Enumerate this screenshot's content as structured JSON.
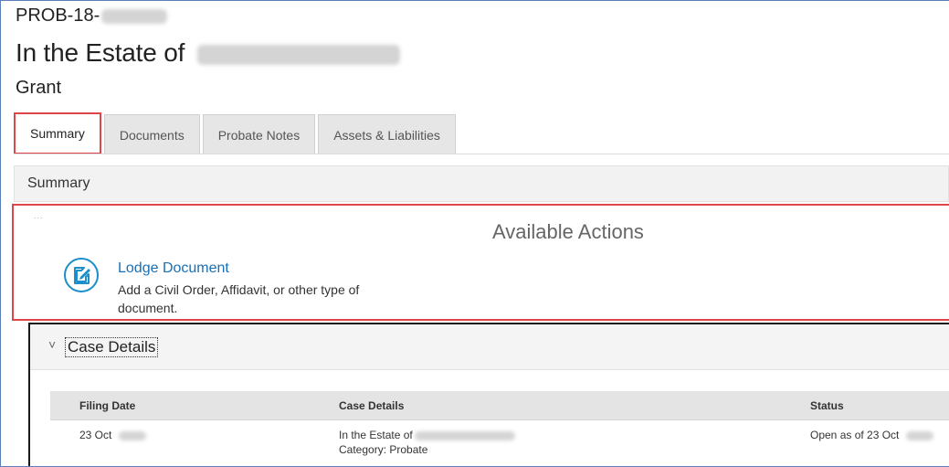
{
  "header": {
    "case_number": "PROB-18-",
    "title_prefix": "In the Estate of",
    "subtitle": "Grant"
  },
  "tabs": [
    {
      "label": "Summary",
      "active": true
    },
    {
      "label": "Documents",
      "active": false
    },
    {
      "label": "Probate Notes",
      "active": false
    },
    {
      "label": "Assets & Liabilities",
      "active": false
    }
  ],
  "summary": {
    "heading": "Summary"
  },
  "actions": {
    "dots": "...",
    "title": "Available Actions",
    "items": [
      {
        "icon": "document-edit-icon",
        "label": "Lodge Document",
        "description": "Add a Civil Order, Affidavit, or other type of document."
      }
    ]
  },
  "case_details": {
    "heading": "Case Details",
    "chevron": "˅",
    "columns": [
      "Filing Date",
      "Case Details",
      "Status"
    ],
    "rows": [
      {
        "filing_date": "23 Oct",
        "case_line1": "In the Estate of",
        "case_line2": "Category: Probate",
        "status": "Open as of 23 Oct"
      }
    ]
  },
  "colors": {
    "highlight": "#e0454b",
    "link": "#1a6fb5",
    "icon": "#1a8fc9"
  }
}
